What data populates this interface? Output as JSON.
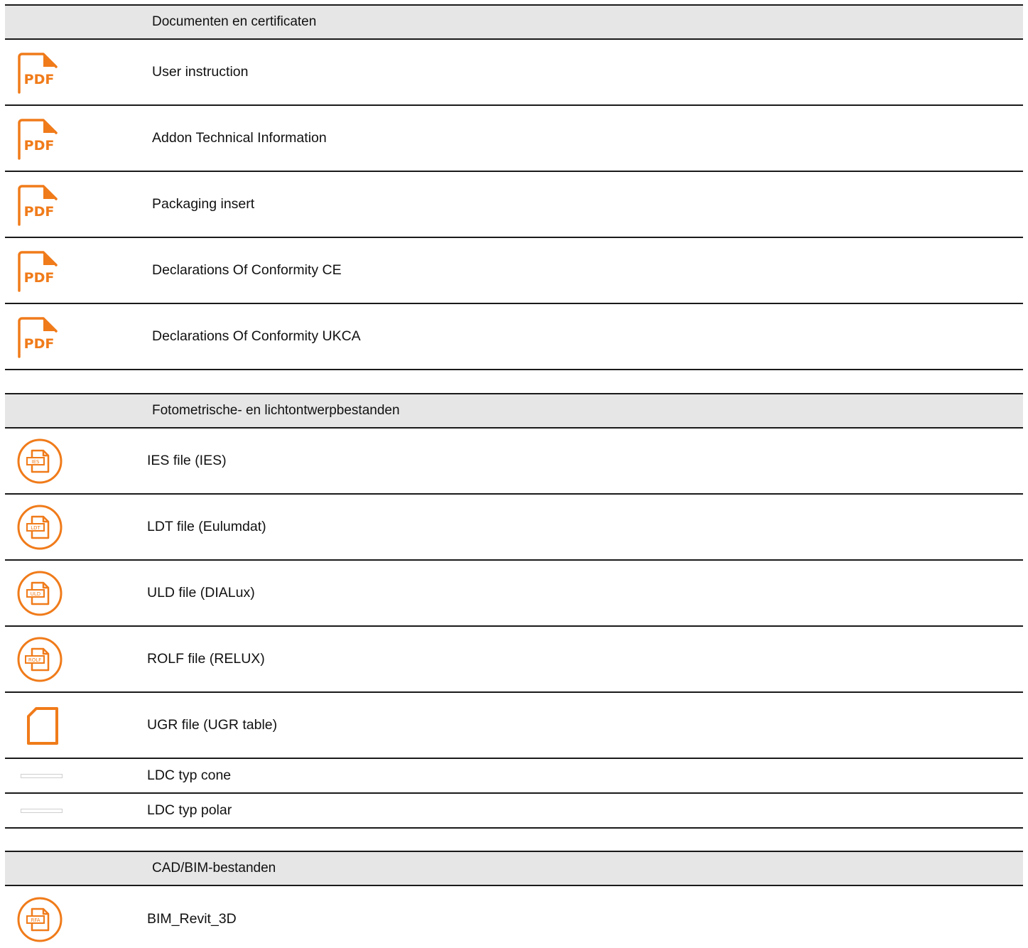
{
  "colors": {
    "accent": "#f07b1a",
    "header_bg": "#e6e6e6",
    "divider": "#1a1a1a"
  },
  "sections": [
    {
      "title": "Documenten en certificaten",
      "items": [
        {
          "label": "User instruction",
          "icon": "pdf-file-icon",
          "icon_text": "PDF"
        },
        {
          "label": "Addon Technical Information",
          "icon": "pdf-file-icon",
          "icon_text": "PDF"
        },
        {
          "label": "Packaging insert",
          "icon": "pdf-file-icon",
          "icon_text": "PDF"
        },
        {
          "label": "Declarations Of Conformity CE",
          "icon": "pdf-file-icon",
          "icon_text": "PDF"
        },
        {
          "label": "Declarations Of Conformity UKCA",
          "icon": "pdf-file-icon",
          "icon_text": "PDF"
        }
      ]
    },
    {
      "title": "Fotometrische- en lichtontwerpbestanden",
      "items": [
        {
          "label": "IES file (IES)",
          "icon": "ies-file-icon",
          "icon_text": "IES"
        },
        {
          "label": "LDT file (Eulumdat)",
          "icon": "ldt-file-icon",
          "icon_text": "LDT"
        },
        {
          "label": "ULD file (DIALux)",
          "icon": "uld-file-icon",
          "icon_text": "ULD"
        },
        {
          "label": "ROLF file (RELUX)",
          "icon": "rolf-file-icon",
          "icon_text": "ROLF"
        },
        {
          "label": "UGR file (UGR table)",
          "icon": "blank-file-icon"
        },
        {
          "label": "LDC typ cone",
          "icon": "image-placeholder-icon"
        },
        {
          "label": "LDC typ polar",
          "icon": "image-placeholder-icon"
        }
      ]
    },
    {
      "title": "CAD/BIM-bestanden",
      "items": [
        {
          "label": "BIM_Revit_3D",
          "icon": "rfa-file-icon",
          "icon_text": "RFA"
        }
      ]
    }
  ]
}
